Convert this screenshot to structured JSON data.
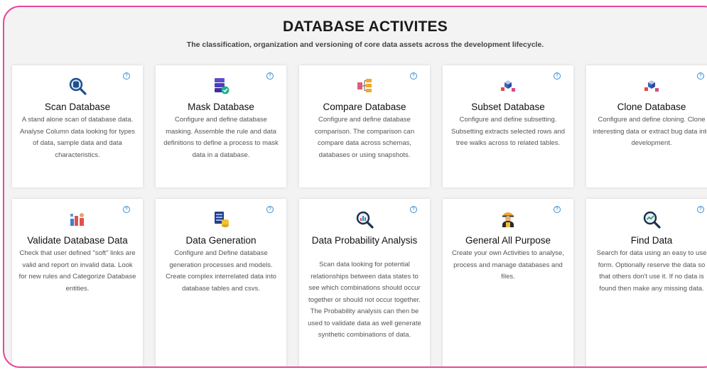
{
  "header": {
    "title": "DATABASE ACTIVITES",
    "subtitle": "The classification, organization and versioning of core data assets across the development lifecycle."
  },
  "help_glyph": "?",
  "colors": {
    "frame_border": "#e8479b",
    "help_icon": "#3a8fd8",
    "background": "#f3f3f3"
  },
  "cards": [
    {
      "title": "Scan Database",
      "icon": "magnifier-database-icon",
      "description": "A stand alone scan of database data. Analyse Column data looking for types of data, sample data and data characteristics."
    },
    {
      "title": "Mask Database",
      "icon": "database-shield-icon",
      "description": "Configure and define database masking. Assemble the rule and data definitions to define a process to mask data in a database."
    },
    {
      "title": "Compare Database",
      "icon": "compare-databases-icon",
      "description": "Configure and define database comparison. The comparison can compare data across schemas, databases or using snapshots."
    },
    {
      "title": "Subset Database",
      "icon": "subset-cubes-icon",
      "description": "Configure and define subsetting. Subsetting extracts selected rows and tree walks across to related tables."
    },
    {
      "title": "Clone Database",
      "icon": "clone-cubes-icon",
      "description": "Configure and define cloning. Clone interesting data or extract bug data into development."
    },
    {
      "title": "Validate Database Data",
      "icon": "validate-users-icon",
      "description": "Check that user defined \"soft\" links are valid and report on invalid data. Look for new rules and Categorize Database entities."
    },
    {
      "title": "Data Generation",
      "icon": "data-generation-icon",
      "description": "Configure and Define database generation processes and models. Create complex interrelated data into database tables and csvs."
    },
    {
      "title": "Data Probability Analysis",
      "icon": "probability-chart-icon",
      "description": "Scan data looking for potential relationships between data states to see which combinations should occur together or should not occur together. The Probability analysis can then be used to validate data as well generate synthetic combinations of data."
    },
    {
      "title": "General All Purpose",
      "icon": "worker-icon",
      "description": "Create your own Activities to analyse, process and manage databases and files."
    },
    {
      "title": "Find Data",
      "icon": "find-data-icon",
      "description": "Search for data using an easy to use form. Optionally reserve the data so that others don't use it. If no data is found then make any missing data."
    }
  ]
}
